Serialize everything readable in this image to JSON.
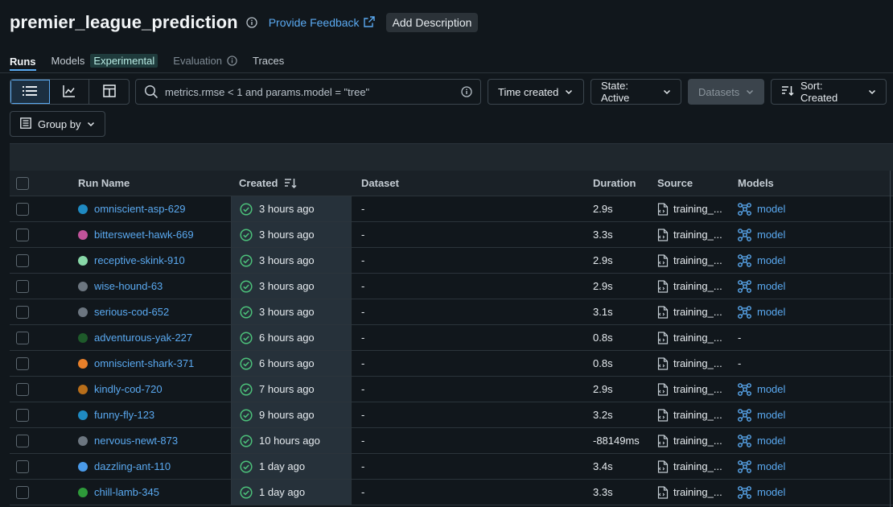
{
  "header": {
    "title": "premier_league_prediction",
    "feedback_label": "Provide Feedback",
    "add_description_label": "Add Description"
  },
  "tabs": [
    {
      "label": "Runs"
    },
    {
      "label": "Models",
      "badge": "Experimental"
    },
    {
      "label": "Evaluation"
    },
    {
      "label": "Traces"
    }
  ],
  "toolbar": {
    "search_value": "metrics.rmse < 1 and params.model = \"tree\"",
    "time_created_label": "Time created",
    "state_label": "State: Active",
    "datasets_label": "Datasets",
    "sort_label": "Sort: Created",
    "group_by_label": "Group by"
  },
  "columns": {
    "run_name": "Run Name",
    "created": "Created",
    "dataset": "Dataset",
    "duration": "Duration",
    "source": "Source",
    "models": "Models"
  },
  "colors": {
    "accent": "#5aa9f0",
    "success": "#4cc07a"
  },
  "runs": [
    {
      "name": "omniscient-asp-629",
      "color": "#1f8ac2",
      "created": "3 hours ago",
      "dataset": "-",
      "duration": "2.9s",
      "source": "training_...",
      "model": "model"
    },
    {
      "name": "bittersweet-hawk-669",
      "color": "#c1539a",
      "created": "3 hours ago",
      "dataset": "-",
      "duration": "3.3s",
      "source": "training_...",
      "model": "model"
    },
    {
      "name": "receptive-skink-910",
      "color": "#88d8a8",
      "created": "3 hours ago",
      "dataset": "-",
      "duration": "2.9s",
      "source": "training_...",
      "model": "model"
    },
    {
      "name": "wise-hound-63",
      "color": "#6c7680",
      "created": "3 hours ago",
      "dataset": "-",
      "duration": "2.9s",
      "source": "training_...",
      "model": "model"
    },
    {
      "name": "serious-cod-652",
      "color": "#6c7680",
      "created": "3 hours ago",
      "dataset": "-",
      "duration": "3.1s",
      "source": "training_...",
      "model": "model"
    },
    {
      "name": "adventurous-yak-227",
      "color": "#1e5a2a",
      "created": "6 hours ago",
      "dataset": "-",
      "duration": "0.8s",
      "source": "training_...",
      "model": "-"
    },
    {
      "name": "omniscient-shark-371",
      "color": "#e8802a",
      "created": "6 hours ago",
      "dataset": "-",
      "duration": "0.8s",
      "source": "training_...",
      "model": "-"
    },
    {
      "name": "kindly-cod-720",
      "color": "#b86e1a",
      "created": "7 hours ago",
      "dataset": "-",
      "duration": "2.9s",
      "source": "training_...",
      "model": "model"
    },
    {
      "name": "funny-fly-123",
      "color": "#1f8ac2",
      "created": "9 hours ago",
      "dataset": "-",
      "duration": "3.2s",
      "source": "training_...",
      "model": "model"
    },
    {
      "name": "nervous-newt-873",
      "color": "#6c7680",
      "created": "10 hours ago",
      "dataset": "-",
      "duration": "-88149ms",
      "source": "training_...",
      "model": "model"
    },
    {
      "name": "dazzling-ant-110",
      "color": "#4a9ae8",
      "created": "1 day ago",
      "dataset": "-",
      "duration": "3.4s",
      "source": "training_...",
      "model": "model"
    },
    {
      "name": "chill-lamb-345",
      "color": "#2e9a3a",
      "created": "1 day ago",
      "dataset": "-",
      "duration": "3.3s",
      "source": "training_...",
      "model": "model"
    }
  ]
}
